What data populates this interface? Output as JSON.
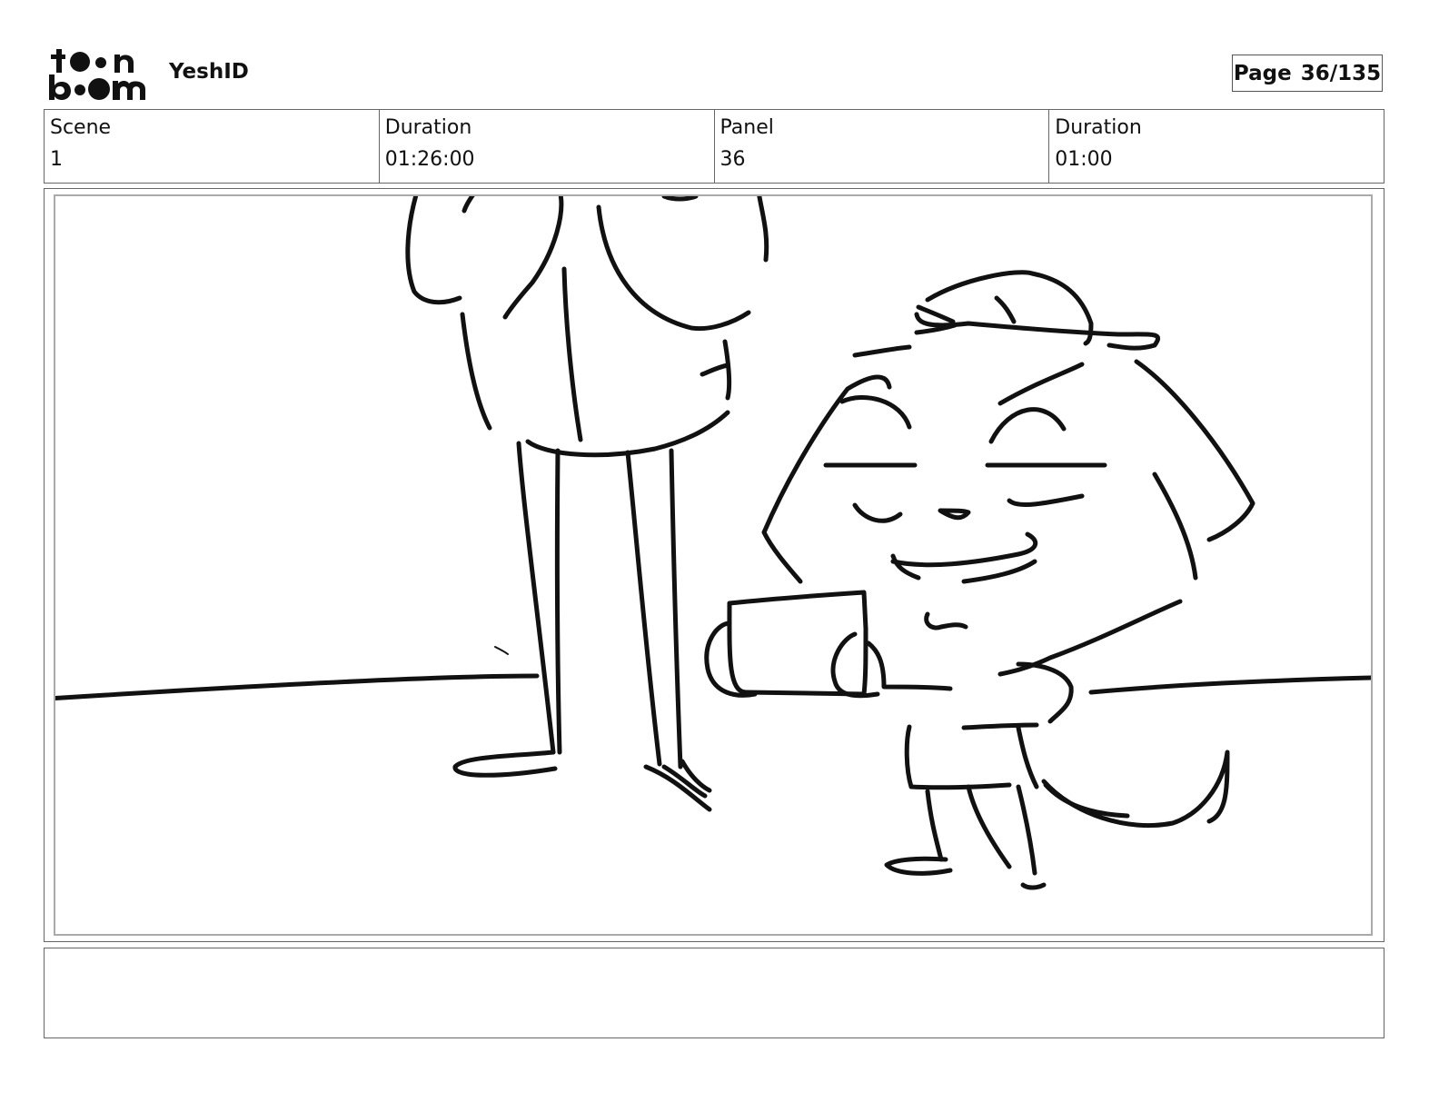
{
  "header": {
    "logo_text": "toon boom",
    "project_title": "YeshID",
    "page_label": "Page",
    "page_value": "36/135"
  },
  "info": {
    "scene_label": "Scene",
    "scene_value": "1",
    "scene_duration_label": "Duration",
    "scene_duration_value": "01:26:00",
    "panel_label": "Panel",
    "panel_value": "36",
    "panel_duration_label": "Duration",
    "panel_duration_value": "01:00"
  },
  "notes": {
    "text": ""
  }
}
